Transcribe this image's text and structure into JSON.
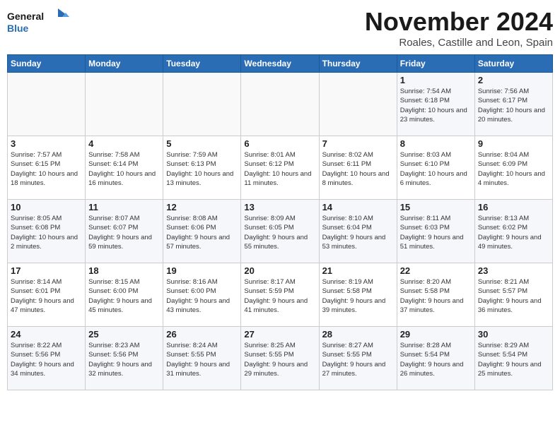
{
  "header": {
    "logo_line1": "General",
    "logo_line2": "Blue",
    "month": "November 2024",
    "location": "Roales, Castille and Leon, Spain"
  },
  "weekdays": [
    "Sunday",
    "Monday",
    "Tuesday",
    "Wednesday",
    "Thursday",
    "Friday",
    "Saturday"
  ],
  "weeks": [
    [
      {
        "day": "",
        "info": ""
      },
      {
        "day": "",
        "info": ""
      },
      {
        "day": "",
        "info": ""
      },
      {
        "day": "",
        "info": ""
      },
      {
        "day": "",
        "info": ""
      },
      {
        "day": "1",
        "info": "Sunrise: 7:54 AM\nSunset: 6:18 PM\nDaylight: 10 hours and 23 minutes."
      },
      {
        "day": "2",
        "info": "Sunrise: 7:56 AM\nSunset: 6:17 PM\nDaylight: 10 hours and 20 minutes."
      }
    ],
    [
      {
        "day": "3",
        "info": "Sunrise: 7:57 AM\nSunset: 6:15 PM\nDaylight: 10 hours and 18 minutes."
      },
      {
        "day": "4",
        "info": "Sunrise: 7:58 AM\nSunset: 6:14 PM\nDaylight: 10 hours and 16 minutes."
      },
      {
        "day": "5",
        "info": "Sunrise: 7:59 AM\nSunset: 6:13 PM\nDaylight: 10 hours and 13 minutes."
      },
      {
        "day": "6",
        "info": "Sunrise: 8:01 AM\nSunset: 6:12 PM\nDaylight: 10 hours and 11 minutes."
      },
      {
        "day": "7",
        "info": "Sunrise: 8:02 AM\nSunset: 6:11 PM\nDaylight: 10 hours and 8 minutes."
      },
      {
        "day": "8",
        "info": "Sunrise: 8:03 AM\nSunset: 6:10 PM\nDaylight: 10 hours and 6 minutes."
      },
      {
        "day": "9",
        "info": "Sunrise: 8:04 AM\nSunset: 6:09 PM\nDaylight: 10 hours and 4 minutes."
      }
    ],
    [
      {
        "day": "10",
        "info": "Sunrise: 8:05 AM\nSunset: 6:08 PM\nDaylight: 10 hours and 2 minutes."
      },
      {
        "day": "11",
        "info": "Sunrise: 8:07 AM\nSunset: 6:07 PM\nDaylight: 9 hours and 59 minutes."
      },
      {
        "day": "12",
        "info": "Sunrise: 8:08 AM\nSunset: 6:06 PM\nDaylight: 9 hours and 57 minutes."
      },
      {
        "day": "13",
        "info": "Sunrise: 8:09 AM\nSunset: 6:05 PM\nDaylight: 9 hours and 55 minutes."
      },
      {
        "day": "14",
        "info": "Sunrise: 8:10 AM\nSunset: 6:04 PM\nDaylight: 9 hours and 53 minutes."
      },
      {
        "day": "15",
        "info": "Sunrise: 8:11 AM\nSunset: 6:03 PM\nDaylight: 9 hours and 51 minutes."
      },
      {
        "day": "16",
        "info": "Sunrise: 8:13 AM\nSunset: 6:02 PM\nDaylight: 9 hours and 49 minutes."
      }
    ],
    [
      {
        "day": "17",
        "info": "Sunrise: 8:14 AM\nSunset: 6:01 PM\nDaylight: 9 hours and 47 minutes."
      },
      {
        "day": "18",
        "info": "Sunrise: 8:15 AM\nSunset: 6:00 PM\nDaylight: 9 hours and 45 minutes."
      },
      {
        "day": "19",
        "info": "Sunrise: 8:16 AM\nSunset: 6:00 PM\nDaylight: 9 hours and 43 minutes."
      },
      {
        "day": "20",
        "info": "Sunrise: 8:17 AM\nSunset: 5:59 PM\nDaylight: 9 hours and 41 minutes."
      },
      {
        "day": "21",
        "info": "Sunrise: 8:19 AM\nSunset: 5:58 PM\nDaylight: 9 hours and 39 minutes."
      },
      {
        "day": "22",
        "info": "Sunrise: 8:20 AM\nSunset: 5:58 PM\nDaylight: 9 hours and 37 minutes."
      },
      {
        "day": "23",
        "info": "Sunrise: 8:21 AM\nSunset: 5:57 PM\nDaylight: 9 hours and 36 minutes."
      }
    ],
    [
      {
        "day": "24",
        "info": "Sunrise: 8:22 AM\nSunset: 5:56 PM\nDaylight: 9 hours and 34 minutes."
      },
      {
        "day": "25",
        "info": "Sunrise: 8:23 AM\nSunset: 5:56 PM\nDaylight: 9 hours and 32 minutes."
      },
      {
        "day": "26",
        "info": "Sunrise: 8:24 AM\nSunset: 5:55 PM\nDaylight: 9 hours and 31 minutes."
      },
      {
        "day": "27",
        "info": "Sunrise: 8:25 AM\nSunset: 5:55 PM\nDaylight: 9 hours and 29 minutes."
      },
      {
        "day": "28",
        "info": "Sunrise: 8:27 AM\nSunset: 5:55 PM\nDaylight: 9 hours and 27 minutes."
      },
      {
        "day": "29",
        "info": "Sunrise: 8:28 AM\nSunset: 5:54 PM\nDaylight: 9 hours and 26 minutes."
      },
      {
        "day": "30",
        "info": "Sunrise: 8:29 AM\nSunset: 5:54 PM\nDaylight: 9 hours and 25 minutes."
      }
    ]
  ]
}
